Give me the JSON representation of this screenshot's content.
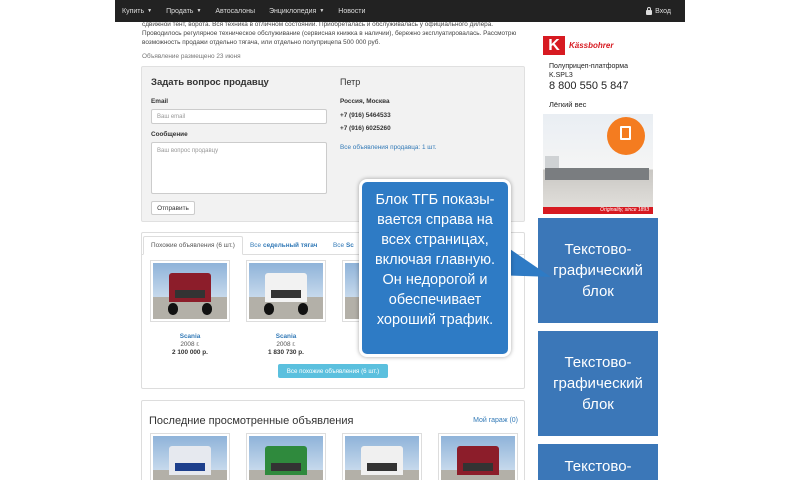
{
  "navbar": {
    "items": [
      {
        "label": "Купить",
        "dropdown": true
      },
      {
        "label": "Продать",
        "dropdown": true
      },
      {
        "label": "Автосалоны",
        "dropdown": false
      },
      {
        "label": "Энциклопедия",
        "dropdown": true
      },
      {
        "label": "Новости",
        "dropdown": false
      }
    ],
    "login_label": "Вход"
  },
  "description": {
    "line1": "сдвижной тент, ворота. Вся техника в отличном состоянии. Приобреталась и обслуживалась у официального дилера.",
    "line2": "Проводилось регулярное техническое обслуживание (сервисная книжка в наличии), бережно эксплуатировалась. Рассмотрю",
    "line3": "возможность продажи отдельно тягача, или отдельно полуприцепа 500 000 руб.",
    "posted": "Объявление размещено 23 июня"
  },
  "contact": {
    "title": "Задать вопрос продавцу",
    "email_label": "Email",
    "email_placeholder": "Ваш email",
    "message_label": "Сообщение",
    "message_placeholder": "Ваш вопрос продавцу",
    "send_label": "Отправить",
    "seller_name": "Петр",
    "location": "Россия, Москва",
    "phone1": "+7 (916) 5464533",
    "phone2": "+7 (916) 6025260",
    "seller_link": "Все объявления продавца: 1 шт."
  },
  "similar": {
    "tab_active": "Похожие объявления (6 шт.)",
    "tab2_prefix": "Все",
    "tab2_bold": "седельный тягач",
    "tab3_prefix": "Все",
    "tab3_bold": "Sc",
    "cards": [
      {
        "brand": "Scania",
        "year": "2008 г.",
        "price": "2 100 000 р."
      },
      {
        "brand": "Scania",
        "year": "2008 г.",
        "price": "1 830 730 р."
      }
    ],
    "button_label": "Все похожие объявления (6 шт.)"
  },
  "recent": {
    "title": "Последние просмотренные объявления",
    "garage_link": "Мой гараж (0)"
  },
  "sidebar_ad": {
    "brand": "Kässbohrer",
    "logo_letter": "K",
    "product_line1": "Полуприцеп-платформа",
    "product_line2": "K.SPL3",
    "phone": "8 800 550 5 847",
    "tagline": "Лёгкий вес",
    "slogan": "Originality, since 1893"
  },
  "tgb_blocks": [
    {
      "line1": "Текстово-",
      "line2": "графический",
      "line3": "блок"
    },
    {
      "line1": "Текстово-",
      "line2": "графический",
      "line3": "блок"
    },
    {
      "line1": "Текстово-",
      "line2": "",
      "line3": ""
    }
  ],
  "callout": {
    "text": "Блок ТГБ показы-вается справа на всех страницах, включая главную. Он недорогой и обеспечивает хороший трафик."
  },
  "colors": {
    "navbar_bg": "#222222",
    "link": "#337ab7",
    "tgb_bg": "#3b77b8",
    "callout_bg": "#2e7bc5",
    "info_button": "#5bc0de",
    "kass_red": "#d71a21"
  },
  "icons": {
    "login": "lock-icon",
    "dropdown": "caret-down-icon"
  }
}
